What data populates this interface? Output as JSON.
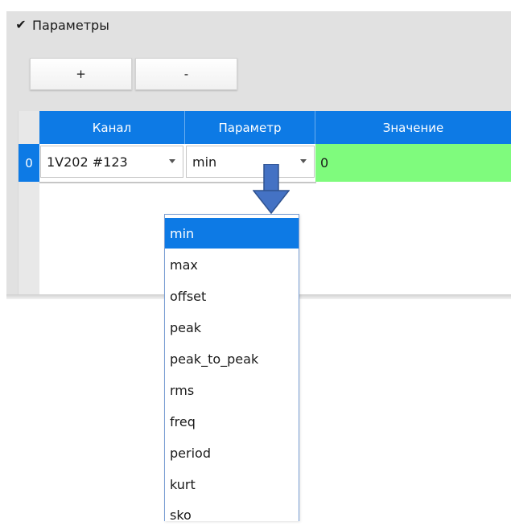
{
  "section": {
    "checked": true,
    "check_glyph": "✔",
    "title": "Параметры"
  },
  "toolbar": {
    "add_label": "+",
    "remove_label": "-"
  },
  "grid": {
    "columns": [
      "Канал",
      "Параметр",
      "Значение"
    ],
    "rows": [
      {
        "index": "0",
        "channel": "1V202 #123",
        "parameter": "min",
        "value": "0"
      }
    ],
    "value_bg_color": "#7ffb7d",
    "header_color": "#0d7ae5"
  },
  "dropdown": {
    "selected": "min",
    "options": [
      "min",
      "max",
      "offset",
      "peak",
      "peak_to_peak",
      "rms",
      "freq",
      "period",
      "kurt",
      "sko"
    ]
  },
  "annotation": {
    "arrow_color": "#4472c4",
    "icon": "down-arrow-icon"
  }
}
